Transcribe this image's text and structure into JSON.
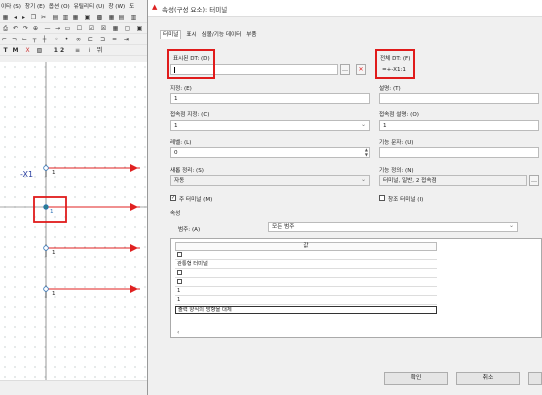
{
  "app": {
    "menu": [
      "이타 (S)",
      "창기 (E)",
      "옵션 (O)",
      "유틸리티 (U)",
      "창 (W)",
      "도"
    ],
    "toolbar_row3_text": [
      "T",
      "M",
      "X",
      "1 2",
      "뛰"
    ]
  },
  "canvas": {
    "device_tag": "-X1",
    "pin_label": "1",
    "colors": {
      "wire": "#e02020",
      "pin": "#2a6fb5",
      "highlight": "#e01b1b"
    }
  },
  "dialog": {
    "title": "속성(구성 요소): 터미널",
    "tabs": [
      "터미널",
      "표시",
      "심볼/기능 데이터",
      "부품"
    ],
    "active_tab": "터미널",
    "fields": {
      "display_dt_label": "표시된 DT: (D)",
      "display_dt_value": "",
      "full_dt_label": "전체 DT: (F)",
      "full_dt_value": "=+-X1:1",
      "designation_label": "지정: (E)",
      "designation_value": "1",
      "description_label": "설명: (T)",
      "description_value": "",
      "connection_designation_label": "접속점 지정: (C)",
      "connection_designation_value": "1",
      "connection_description_label": "접속점 설명: (O)",
      "connection_description_value": "1",
      "level_label": "레벨: (L)",
      "level_value": "0",
      "function_text_label": "기능 문자: (U)",
      "function_text_value": "",
      "new_sort_label": "새롭 정리: (S)",
      "new_sort_value": "자동",
      "function_def_label": "기능 정의: (N)",
      "function_def_value": "터미널, 일반, 2 접속점"
    },
    "checks": {
      "main_terminal_label": "주 터미널 (M)",
      "main_terminal_checked": true,
      "spare_terminal_label": "창조 터미널 (I)",
      "spare_terminal_checked": false
    },
    "props": {
      "group_label": "속성",
      "category_label": "범주: (A)",
      "category_value": "모든 범주",
      "column_header": "값",
      "rows": [
        "",
        "관통형 터미널",
        "",
        "",
        "1",
        "1",
        "출력 양식의 방향을 대체"
      ],
      "row_has_checkbox": [
        true,
        false,
        true,
        true,
        false,
        false,
        false
      ]
    },
    "buttons": {
      "ok": "확인",
      "cancel": "취소"
    }
  }
}
